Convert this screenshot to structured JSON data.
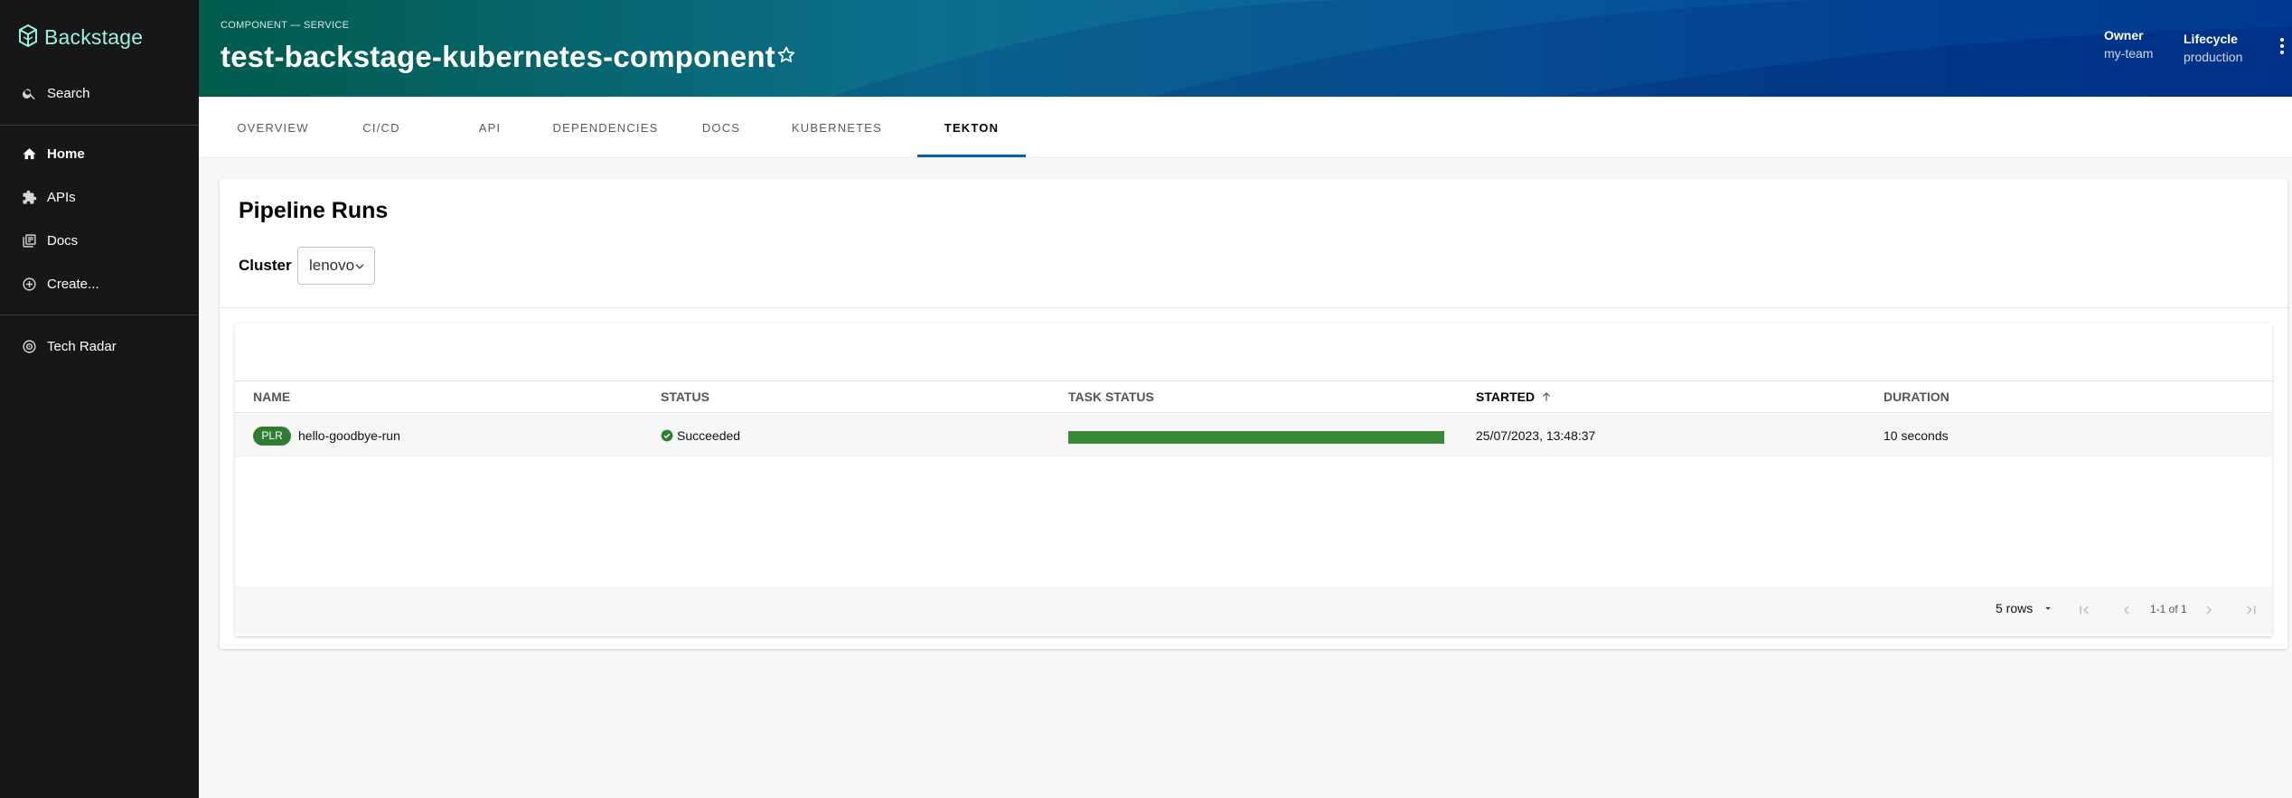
{
  "sidebar": {
    "logo_text": "Backstage",
    "search_label": "Search",
    "items": [
      {
        "label": "Home",
        "icon": "home-icon"
      },
      {
        "label": "APIs",
        "icon": "puzzle-icon"
      },
      {
        "label": "Docs",
        "icon": "library-icon"
      },
      {
        "label": "Create...",
        "icon": "add-circle-icon"
      }
    ],
    "plugins": [
      {
        "label": "Tech Radar",
        "icon": "radar-icon"
      }
    ]
  },
  "header": {
    "breadcrumb": "COMPONENT — SERVICE",
    "title": "test-backstage-kubernetes-component",
    "owner_label": "Owner",
    "owner_value": "my-team",
    "lifecycle_label": "Lifecycle",
    "lifecycle_value": "production"
  },
  "tabs": [
    {
      "label": "OVERVIEW",
      "active": false
    },
    {
      "label": "CI/CD",
      "active": false
    },
    {
      "label": "API",
      "active": false
    },
    {
      "label": "DEPENDENCIES",
      "active": false
    },
    {
      "label": "DOCS",
      "active": false
    },
    {
      "label": "KUBERNETES",
      "active": false
    },
    {
      "label": "TEKTON",
      "active": true
    }
  ],
  "pipeline": {
    "title": "Pipeline Runs",
    "cluster_label": "Cluster",
    "cluster_value": "lenovo",
    "columns": [
      "NAME",
      "STATUS",
      "TASK STATUS",
      "STARTED",
      "DURATION"
    ],
    "sorted_column": "STARTED",
    "rows": [
      {
        "badge": "PLR",
        "name": "hello-goodbye-run",
        "status": "Succeeded",
        "task_status_progress": 1.0,
        "started": "25/07/2023, 13:48:37",
        "duration": "10 seconds"
      }
    ],
    "pagination": {
      "rows_per_page": "5 rows",
      "range": "1-1 of 1"
    }
  },
  "colors": {
    "sidebar_bg": "#171717",
    "logo": "#9BF0E1",
    "header_start": "#005B4B",
    "header_end": "#0045a0",
    "tab_indicator": "#0a5fa1",
    "success": "#2e7d32"
  }
}
